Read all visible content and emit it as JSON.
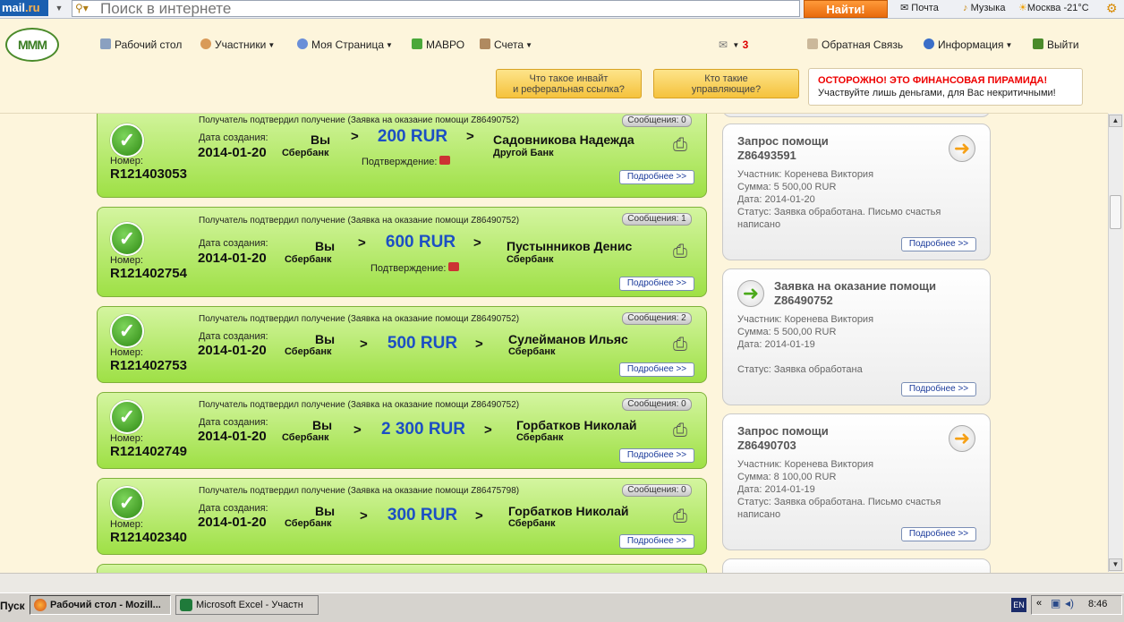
{
  "toolbar": {
    "logo_main": "mail",
    "logo_suffix": ".ru",
    "search_placeholder": "Поиск в интернете",
    "search_button": "Найти!",
    "mail_link": "Почта",
    "music_link": "Музыка",
    "weather": "Москва -21°C"
  },
  "nav": {
    "logo": "MMM",
    "items": [
      {
        "label": "Рабочий стол"
      },
      {
        "label": "Участники"
      },
      {
        "label": "Моя Страница"
      },
      {
        "label": "МАВРО"
      },
      {
        "label": "Счета"
      }
    ],
    "notifications_count": "3",
    "feedback": "Обратная Связь",
    "info": "Информация",
    "logout": "Выйти"
  },
  "banners": {
    "invite_btn_line1": "Что такое инвайт",
    "invite_btn_line2": "и реферальная ссылка?",
    "managers_btn_line1": "Кто такие",
    "managers_btn_line2": "управляющие?",
    "warning_title": "ОСТОРОЖНО! ЭТО ФИНАНСОВАЯ ПИРАМИДА!",
    "warning_text": "Участвуйте лишь деньгами, для Вас некритичными!"
  },
  "labels": {
    "created": "Дата создания:",
    "number": "Номер:",
    "you": "Вы",
    "confirmation": "Подтверждение:",
    "more": "Подробнее >>",
    "gt": ">"
  },
  "transfers": [
    {
      "note": "Получатель подтвердил получение (Заявка на оказание помощи Z86490752)",
      "messages": "Сообщения: 0",
      "date": "2014-01-20",
      "number": "R121403053",
      "sender_bank": "Сбербанк",
      "amount": "200 RUR",
      "recipient": "Садовникова Надежда",
      "recipient_bank": "Другой Банк",
      "has_confirmation": true
    },
    {
      "note": "Получатель подтвердил получение (Заявка на оказание помощи Z86490752)",
      "messages": "Сообщения: 1",
      "date": "2014-01-20",
      "number": "R121402754",
      "sender_bank": "Сбербанк",
      "amount": "600 RUR",
      "recipient": "Пустынников Денис",
      "recipient_bank": "Сбербанк",
      "has_confirmation": true
    },
    {
      "note": "Получатель подтвердил получение (Заявка на оказание помощи Z86490752)",
      "messages": "Сообщения: 2",
      "date": "2014-01-20",
      "number": "R121402753",
      "sender_bank": "Сбербанк",
      "amount": "500 RUR",
      "recipient": "Сулейманов Ильяс",
      "recipient_bank": "Сбербанк",
      "has_confirmation": false
    },
    {
      "note": "Получатель подтвердил получение (Заявка на оказание помощи Z86490752)",
      "messages": "Сообщения: 0",
      "date": "2014-01-20",
      "number": "R121402749",
      "sender_bank": "Сбербанк",
      "amount": "2 300 RUR",
      "recipient": "Горбатков Николай",
      "recipient_bank": "Сбербанк",
      "has_confirmation": false
    },
    {
      "note": "Получатель подтвердил получение (Заявка на оказание помощи Z86475798)",
      "messages": "Сообщения: 0",
      "date": "2014-01-20",
      "number": "R121402340",
      "sender_bank": "Сбербанк",
      "amount": "300 RUR",
      "recipient": "Горбатков Николай",
      "recipient_bank": "Сбербанк",
      "has_confirmation": false
    }
  ],
  "requests": [
    {
      "title": "Запрос помощи",
      "id": "Z86493591",
      "participant": "Участник: Коренева Виктория",
      "sum": "Сумма: 5 500,00 RUR",
      "date": "Дата: 2014-01-20",
      "status1": "Статус: Заявка обработана. Письмо счастья",
      "status2": "написано",
      "icon": "arrow-right-orange-icon"
    },
    {
      "title": "Заявка на оказание помощи",
      "id": "Z86490752",
      "participant": "Участник: Коренева Виктория",
      "sum": "Сумма: 5 500,00 RUR",
      "date": "Дата: 2014-01-19",
      "status1": "Статус: Заявка обработана",
      "status2": "",
      "icon": "arrow-right-green-icon"
    },
    {
      "title": "Запрос помощи",
      "id": "Z86490703",
      "participant": "Участник: Коренева Виктория",
      "sum": "Сумма: 8 100,00 RUR",
      "date": "Дата: 2014-01-19",
      "status1": "Статус: Заявка обработана. Письмо счастья",
      "status2": "написано",
      "icon": "arrow-right-orange-icon"
    }
  ],
  "taskbar": {
    "start": "Пуск",
    "tasks": [
      {
        "label": "Рабочий стол - Mozill..."
      },
      {
        "label": "Microsoft Excel - Участн"
      }
    ],
    "lang": "EN",
    "clock": "8:46"
  }
}
